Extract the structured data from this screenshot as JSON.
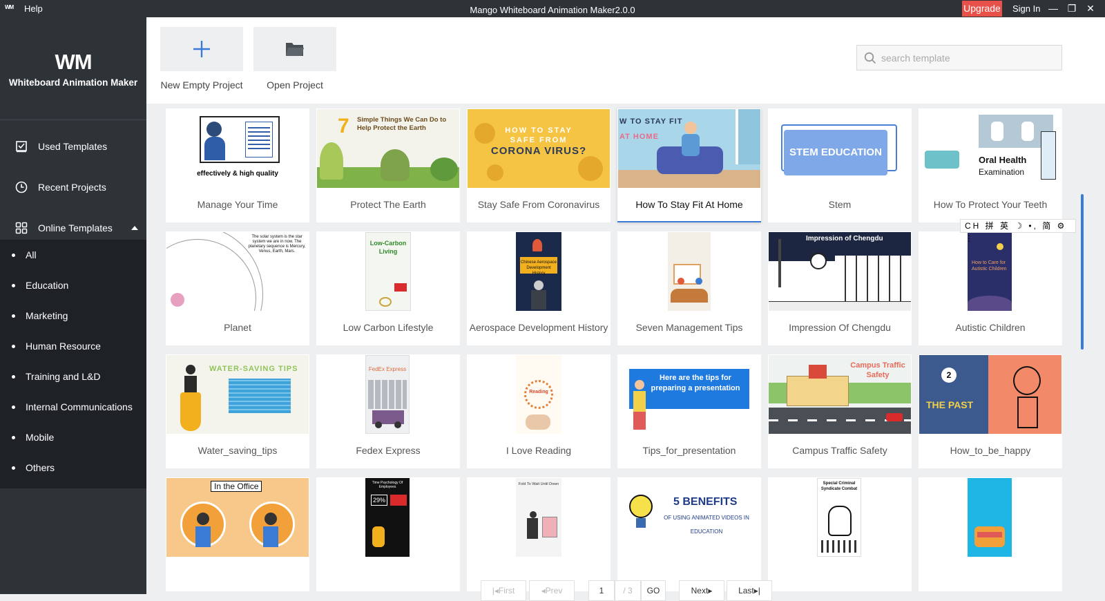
{
  "titlebar": {
    "logo": "WM",
    "help": "Help",
    "title": "Mango Whiteboard Animation Maker2.0.0",
    "upgrade": "Upgrade",
    "signin": "Sign In",
    "minimize": "—",
    "restore": "❐",
    "close": "✕"
  },
  "sidebar": {
    "logo": "WM",
    "app_name": "Whiteboard Animation Maker",
    "items": [
      {
        "label": "Used Templates",
        "icon": "checkbox-icon"
      },
      {
        "label": "Recent Projects",
        "icon": "clock-icon"
      },
      {
        "label": "Online Templates",
        "icon": "grid-icon"
      }
    ],
    "categories": [
      "All",
      "Education",
      "Marketing",
      "Human Resource",
      "Training and L&D",
      "Internal Communications",
      "Mobile",
      "Others"
    ]
  },
  "toolbar": {
    "new_project": "New Empty Project",
    "open_project": "Open Project",
    "search_placeholder": "search template"
  },
  "templates": [
    {
      "name": "Manage Your Time",
      "thumb_text": "effectively & high quality"
    },
    {
      "name": "Protect The Earth",
      "thumb_text": "Simple Things We Can Do to Help Protect the Earth",
      "thumb_num": "7"
    },
    {
      "name": "Stay Safe From Coronavirus",
      "thumb_text": "HOW TO STAY SAFE FROM",
      "thumb_text2": "CORONA VIRUS?"
    },
    {
      "name": "How To Stay Fit At Home",
      "thumb_text": "W TO STAY FIT",
      "thumb_text2": "AT HOME"
    },
    {
      "name": "Stem",
      "thumb_text": "STEM EDUCATION"
    },
    {
      "name": "How To Protect Your Teeth",
      "thumb_text": "Oral Health",
      "thumb_text2": "Examination"
    },
    {
      "name": "Planet",
      "thumb_text": "The solar system is the star system we are in now. The planetary sequence is Mercury, Venus, Earth, Mars."
    },
    {
      "name": "Low Carbon Lifestyle",
      "thumb_text": "Low-Carbon Living"
    },
    {
      "name": "Aerospace Development History",
      "thumb_text": "Chinese Aerospace Development History"
    },
    {
      "name": "Seven Management Tips",
      "thumb_text": ""
    },
    {
      "name": "Impression Of Chengdu",
      "thumb_text": "Impression of Chengdu"
    },
    {
      "name": "Autistic Children",
      "thumb_text": "How to Care for Autistic Children"
    },
    {
      "name": "Water_saving_tips",
      "thumb_text": "WATER-SAVING TIPS"
    },
    {
      "name": "Fedex Express",
      "thumb_text": "FedEx Express"
    },
    {
      "name": "I Love Reading",
      "thumb_text": "Reading"
    },
    {
      "name": "Tips_for_presentation",
      "thumb_text": "Here are the tips for preparing a presentation"
    },
    {
      "name": "Campus Traffic Safety",
      "thumb_text": "Campus Traffic Safety"
    },
    {
      "name": "How_to_be_happy",
      "thumb_text": "THE PAST",
      "thumb_num": "2"
    },
    {
      "name": "",
      "thumb_text": "In the Office"
    },
    {
      "name": "",
      "thumb_text": "Time Psychology Of Employees",
      "thumb_num": "29%"
    },
    {
      "name": "",
      "thumb_text": "Fold To Wait Until Down"
    },
    {
      "name": "",
      "thumb_text": "5 BENEFITS",
      "thumb_text2": "OF USING ANIMATED VIDEOS IN EDUCATION"
    },
    {
      "name": "",
      "thumb_text": "Special Criminal Syndicate Combat"
    },
    {
      "name": "",
      "thumb_text": ""
    }
  ],
  "ime_bar": "CH 拼 英 ☽ •, 简 ⚙ ⋮",
  "pagination": {
    "first": "|◂First",
    "prev": "◂Prev",
    "page": "1",
    "total": "/ 3",
    "go": "GO",
    "next": "Next▸",
    "last": "Last▸|"
  }
}
